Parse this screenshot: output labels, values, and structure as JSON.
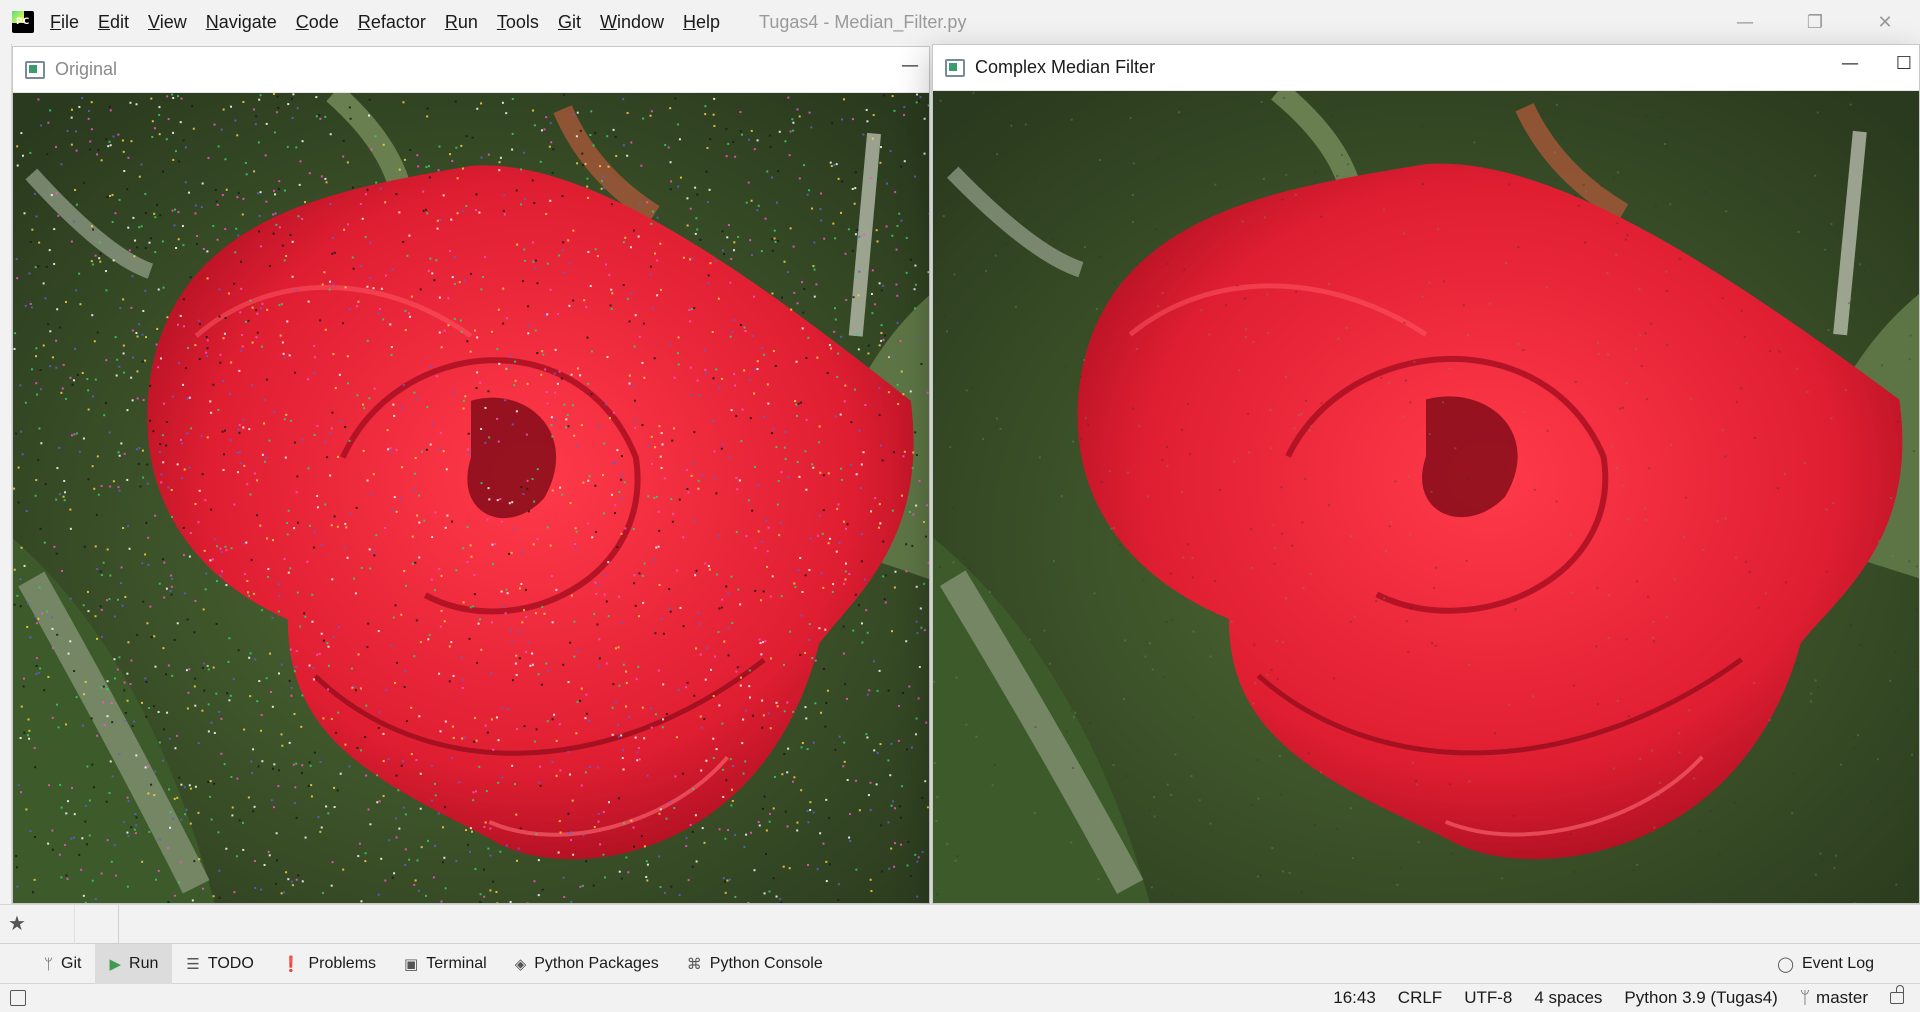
{
  "app": {
    "logo_text": "PC",
    "menu": [
      {
        "label": "File",
        "mnemonic": "F",
        "rest": "ile"
      },
      {
        "label": "Edit",
        "mnemonic": "E",
        "rest": "dit"
      },
      {
        "label": "View",
        "mnemonic": "V",
        "rest": "iew"
      },
      {
        "label": "Navigate",
        "mnemonic": "N",
        "rest": "avigate"
      },
      {
        "label": "Code",
        "mnemonic": "C",
        "rest": "ode"
      },
      {
        "label": "Refactor",
        "mnemonic": "R",
        "rest": "efactor"
      },
      {
        "label": "Run",
        "mnemonic": "R",
        "rest": "un"
      },
      {
        "label": "Tools",
        "mnemonic": "T",
        "rest": "ools"
      },
      {
        "label": "Git",
        "mnemonic": "G",
        "rest": "it"
      },
      {
        "label": "Window",
        "mnemonic": "W",
        "rest": "indow"
      },
      {
        "label": "Help",
        "mnemonic": "H",
        "rest": "elp"
      }
    ],
    "window_title": "Tugas4 - Median_Filter.py",
    "window_controls": {
      "minimize": "—",
      "restore": "❐",
      "close": "✕"
    }
  },
  "windows": {
    "original": {
      "title": "Original",
      "minimize": "—",
      "noise": true
    },
    "filtered": {
      "title": "Complex Median Filter",
      "minimize": "—",
      "maximize": "☐",
      "noise": false
    }
  },
  "tool_windows": {
    "favorites_icon": "star-icon",
    "items": [
      {
        "label": "Git",
        "icon": "branch-icon",
        "glyph": "ᛘ",
        "active": false
      },
      {
        "label": "Run",
        "icon": "run-icon",
        "glyph": "▶",
        "active": true
      },
      {
        "label": "TODO",
        "icon": "list-icon",
        "glyph": "☰",
        "active": false
      },
      {
        "label": "Problems",
        "icon": "warning-icon",
        "glyph": "❗",
        "active": false
      },
      {
        "label": "Terminal",
        "icon": "terminal-icon",
        "glyph": "▣",
        "active": false
      },
      {
        "label": "Python Packages",
        "icon": "layers-icon",
        "glyph": "◈",
        "active": false
      },
      {
        "label": "Python Console",
        "icon": "python-icon",
        "glyph": "⌘",
        "active": false
      }
    ],
    "event_log": "Event Log"
  },
  "statusbar": {
    "time": "16:43",
    "line_separator": "CRLF",
    "encoding": "UTF-8",
    "indent": "4 spaces",
    "interpreter": "Python 3.9 (Tugas4)",
    "branch": "master"
  },
  "colors": {
    "rose_red": "#e01e32",
    "rose_dark": "#a50e1f",
    "leaf_green": "#3d5a2a",
    "background_dark": "#2a3a1e",
    "accent_run": "#3f9c4e"
  }
}
